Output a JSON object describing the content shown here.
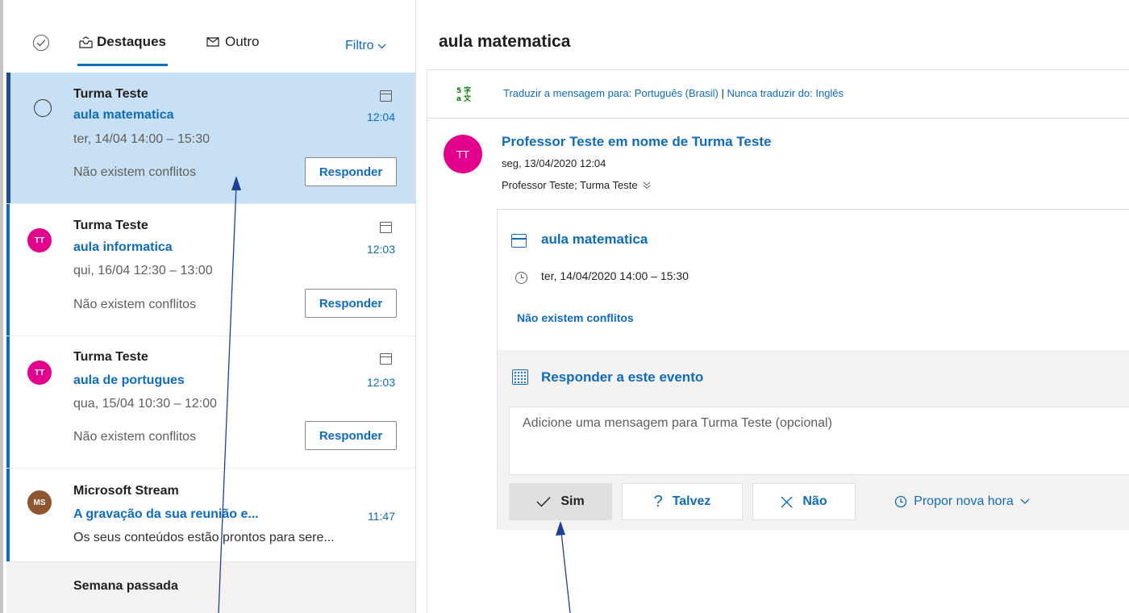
{
  "list": {
    "tabs": [
      {
        "label": "Destaques"
      },
      {
        "label": "Outro"
      }
    ],
    "filter_label": "Filtro",
    "items": [
      {
        "sender": "Turma Teste",
        "subject": "aula matematica",
        "time": "12:04",
        "event_time": "ter, 14/04 14:00 – 15:30",
        "conflicts": "Não existem conflitos",
        "respond_label": "Responder"
      },
      {
        "sender": "Turma Teste",
        "avatar": "TT",
        "subject": "aula informatica",
        "time": "12:03",
        "event_time": "qui, 16/04 12:30 – 13:00",
        "conflicts": "Não existem conflitos",
        "respond_label": "Responder"
      },
      {
        "sender": "Turma Teste",
        "avatar": "TT",
        "subject": "aula de portugues",
        "time": "12:03",
        "event_time": "qua, 15/04 10:30 – 12:00",
        "conflicts": "Não existem conflitos",
        "respond_label": "Responder"
      },
      {
        "sender": "Microsoft Stream",
        "avatar": "MS",
        "subject": "A gravação da sua reunião e...",
        "time": "11:47",
        "preview": "Os seus conteúdos estão prontos para sere..."
      }
    ],
    "group_label": "Semana passada"
  },
  "reading": {
    "title": "aula matematica",
    "translate_prefix": "Traduzir a mensagem para: Português (Brasil)",
    "translate_separator": "|",
    "translate_never": "Nunca traduzir do: Inglês",
    "avatar": "TT",
    "from": "Professor Teste em nome de Turma Teste",
    "date": "seg, 13/04/2020 12:04",
    "to": "Professor Teste; Turma Teste",
    "event": {
      "title": "aula matematica",
      "time": "ter, 14/04/2020 14:00 – 15:30",
      "conflicts": "Não existem conflitos",
      "respond_heading": "Responder a este evento",
      "message_placeholder": "Adicione uma mensagem para Turma Teste (opcional)",
      "yes_label": "Sim",
      "maybe_label": "Talvez",
      "no_label": "Não",
      "propose_label": "Propor nova hora"
    }
  },
  "colors": {
    "accent": "#0f6cbd",
    "selected_bg": "#c7e0f4",
    "avatar_tt": "#e3008c",
    "avatar_ms": "#8e562e",
    "arrow": "#1f3f99"
  },
  "icons": [
    "check-circle-icon",
    "focused-inbox-icon",
    "other-inbox-icon",
    "chevron-down-icon",
    "calendar-icon",
    "translate-icon",
    "chevron-double-down-icon",
    "clock-icon",
    "calendar-respond-icon",
    "checkmark-icon",
    "question-icon",
    "close-icon"
  ]
}
